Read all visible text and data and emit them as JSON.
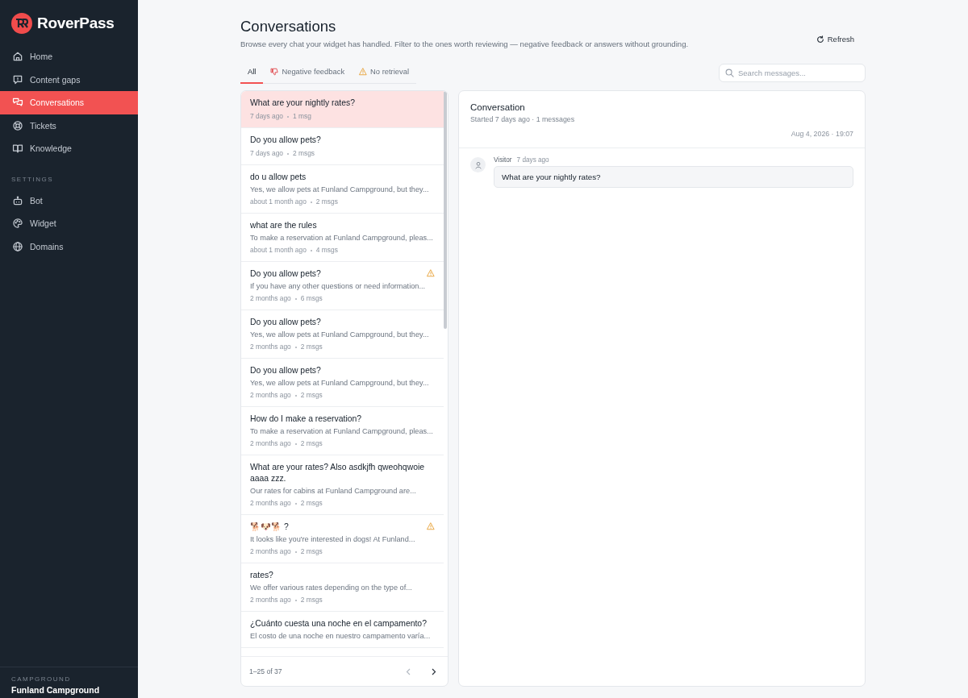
{
  "brand": {
    "name": "RoverPass"
  },
  "sidebar": {
    "items": [
      {
        "label": "Home",
        "selected": false
      },
      {
        "label": "Content gaps",
        "selected": false
      },
      {
        "label": "Conversations",
        "selected": true
      },
      {
        "label": "Tickets",
        "selected": false
      },
      {
        "label": "Knowledge",
        "selected": false
      }
    ],
    "settings_heading": "SETTINGS",
    "settings_items": [
      {
        "label": "Bot",
        "selected": false
      },
      {
        "label": "Widget",
        "selected": false
      },
      {
        "label": "Domains",
        "selected": false
      }
    ],
    "footer": {
      "heading": "CAMPGROUND",
      "name": "Funland Campground"
    }
  },
  "header": {
    "title": "Conversations",
    "subtitle": "Browse every chat your widget has handled. Filter to the ones worth reviewing — negative feedback or answers without grounding.",
    "refresh": "Refresh"
  },
  "tabs": [
    {
      "label": "All",
      "selected": true
    },
    {
      "label": "Negative feedback",
      "selected": false
    },
    {
      "label": "No retrieval",
      "selected": false
    }
  ],
  "search": {
    "placeholder": "Search messages..."
  },
  "conversations": [
    {
      "title": "What are your nightly rates?",
      "time": "7 days ago",
      "count": "1 msg",
      "warning": false,
      "selected": true
    },
    {
      "title": "Do you allow pets?",
      "time": "7 days ago",
      "count": "2 msgs",
      "warning": false,
      "selected": false
    },
    {
      "title": "do u allow pets",
      "preview": "Yes, we allow pets at Funland Campground, but they...",
      "time": "about 1 month ago",
      "count": "2 msgs",
      "warning": false,
      "selected": false
    },
    {
      "title": "what are the rules",
      "preview": "To make a reservation at Funland Campground, pleas...",
      "time": "about 1 month ago",
      "count": "4 msgs",
      "warning": false,
      "selected": false
    },
    {
      "title": "Do you allow pets?",
      "preview": "If you have any other questions or need information...",
      "time": "2 months ago",
      "count": "6 msgs",
      "warning": true,
      "selected": false
    },
    {
      "title": "Do you allow pets?",
      "preview": "Yes, we allow pets at Funland Campground, but they...",
      "time": "2 months ago",
      "count": "2 msgs",
      "warning": false,
      "selected": false
    },
    {
      "title": "Do you allow pets?",
      "preview": "Yes, we allow pets at Funland Campground, but they...",
      "time": "2 months ago",
      "count": "2 msgs",
      "warning": false,
      "selected": false
    },
    {
      "title": "How do I make a reservation?",
      "preview": "To make a reservation at Funland Campground, pleas...",
      "time": "2 months ago",
      "count": "2 msgs",
      "warning": false,
      "selected": false
    },
    {
      "title": "What are your rates? Also asdkjfh qweohqwoie aaaa zzz.",
      "preview": "Our rates for cabins at Funland Campground are...",
      "time": "2 months ago",
      "count": "2 msgs",
      "warning": false,
      "selected": false
    },
    {
      "title": "🐕🐶🐕 ?",
      "preview": "It looks like you're interested in dogs! At Funland...",
      "time": "2 months ago",
      "count": "2 msgs",
      "warning": true,
      "selected": false
    },
    {
      "title": "rates?",
      "preview": "We offer various rates depending on the type of...",
      "time": "2 months ago",
      "count": "2 msgs",
      "warning": false,
      "selected": false
    },
    {
      "title": "¿Cuánto cuesta una noche en el campamento?",
      "preview": "El costo de una noche en nuestro campamento varía...",
      "selected": false,
      "warning": false
    }
  ],
  "pagination": {
    "range": "1–25 of 37"
  },
  "detail": {
    "title": "Conversation",
    "subtitle": "Started 7 days ago · 1 messages",
    "timestamp": "Aug 4, 2026 · 19:07",
    "messages": [
      {
        "sender": "Visitor",
        "time": "7 days ago",
        "text": "What are your nightly rates?"
      }
    ]
  }
}
